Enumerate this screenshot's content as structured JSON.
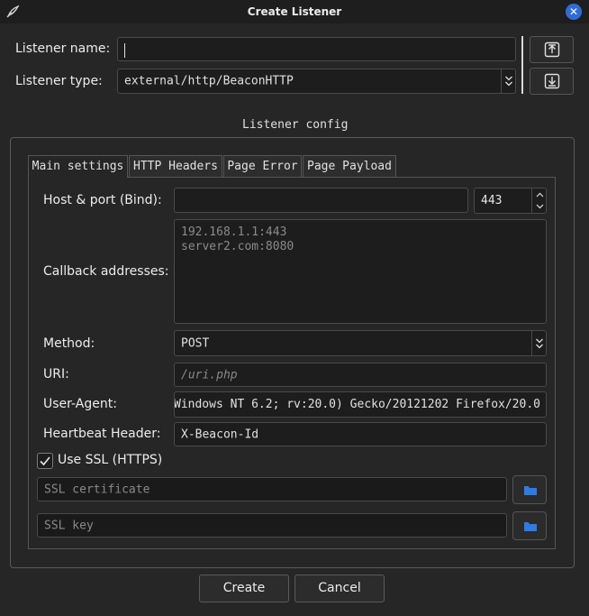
{
  "window": {
    "title": "Create Listener",
    "icon": "feather-icon",
    "close_icon": "close-icon"
  },
  "listener": {
    "name_label": "Listener name:",
    "name_value": "",
    "type_label": "Listener type:",
    "type_value": "external/http/BeaconHTTP",
    "upload_icon": "upload-icon",
    "download_icon": "download-icon"
  },
  "config": {
    "group_title": "Listener config",
    "tabs": [
      "Main settings",
      "HTTP Headers",
      "Page Error",
      "Page Payload"
    ],
    "active_tab": "Main settings",
    "host_port_label": "Host & port (Bind):",
    "host_value": "",
    "port_value": "443",
    "callback_label": "Callback addresses:",
    "callback_placeholder_line1": "192.168.1.1:443",
    "callback_placeholder_line2": "server2.com:8080",
    "method_label": "Method:",
    "method_value": "POST",
    "uri_label": "URI:",
    "uri_placeholder": "/uri.php",
    "user_agent_label": "User-Agent:",
    "user_agent_value": "Windows NT 6.2; rv:20.0) Gecko/20121202 Firefox/20.0",
    "heartbeat_label": "Heartbeat Header:",
    "heartbeat_value": "X-Beacon-Id",
    "ssl_label": "Use SSL (HTTPS)",
    "ssl_checked": true,
    "ssl_cert_placeholder": "SSL certificate",
    "ssl_key_placeholder": "SSL key",
    "folder_icon": "folder-icon",
    "folder_color": "#2f7ae5"
  },
  "buttons": {
    "create": "Create",
    "cancel": "Cancel"
  }
}
